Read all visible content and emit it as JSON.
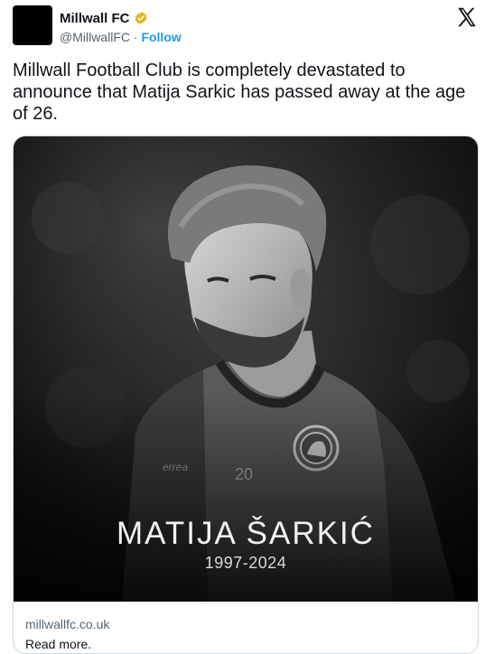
{
  "account": {
    "display_name": "Millwall FC",
    "handle": "@MillwallFC",
    "separator": " · ",
    "follow_label": "Follow",
    "verified_color": "#e2b719"
  },
  "platform_icon": "x-logo-icon",
  "tweet": {
    "text": "Millwall Football Club is completely devastated to announce that Matija Sarkic has passed away at the age of 26."
  },
  "card": {
    "title": "MATIJA ŠARKIĆ",
    "years": "1997-2024",
    "shirt_number": "20",
    "domain": "millwallfc.co.uk",
    "read_more": "Read more."
  },
  "colors": {
    "text_primary": "#0f1419",
    "text_secondary": "#536471",
    "link_blue": "#1d9bf0",
    "border": "#cfd9de"
  }
}
